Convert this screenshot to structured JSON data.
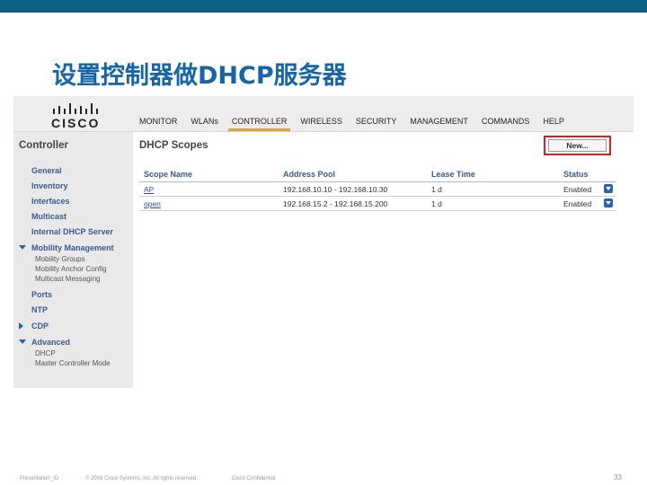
{
  "slide": {
    "title": "设置控制器做DHCP服务器",
    "accent_color": "#0e5f86",
    "title_color": "#1565a8"
  },
  "app": {
    "logo_text": "CISCO",
    "nav": [
      "MONITOR",
      "WLANs",
      "CONTROLLER",
      "WIRELESS",
      "SECURITY",
      "MANAGEMENT",
      "COMMANDS",
      "HELP"
    ],
    "active_nav": "CONTROLLER",
    "highlight_color": "#e21b1b"
  },
  "sidebar": {
    "title": "Controller",
    "items": [
      {
        "label": "General"
      },
      {
        "label": "Inventory"
      },
      {
        "label": "Interfaces"
      },
      {
        "label": "Multicast"
      },
      {
        "label": "Internal DHCP Server"
      },
      {
        "label": "Mobility Management",
        "expanded": true,
        "children": [
          "Mobility Groups",
          "Mobility Anchor Config",
          "Multicast Messaging"
        ]
      },
      {
        "label": "Ports"
      },
      {
        "label": "NTP"
      },
      {
        "label": "CDP",
        "collapsed": true
      },
      {
        "label": "Advanced",
        "expanded": true,
        "children": [
          "DHCP",
          "Master Controller Mode"
        ]
      }
    ]
  },
  "content": {
    "title": "DHCP Scopes",
    "new_button": "New...",
    "table": {
      "headers": [
        "Scope Name",
        "Address Pool",
        "Lease Time",
        "Status"
      ],
      "rows": [
        [
          "AP",
          "192.168.10.10 - 192.168.10.30",
          "1 d",
          "Enabled"
        ],
        [
          "open",
          "192.168.15.2 - 192.168.15.200",
          "1 d",
          "Enabled"
        ]
      ]
    }
  },
  "footer": {
    "presentation_id": "Presentation_ID",
    "copyright": "© 2006 Cisco Systems, Inc. All rights reserved.",
    "confidential": "Cisco Confidential",
    "page_number": "33"
  }
}
